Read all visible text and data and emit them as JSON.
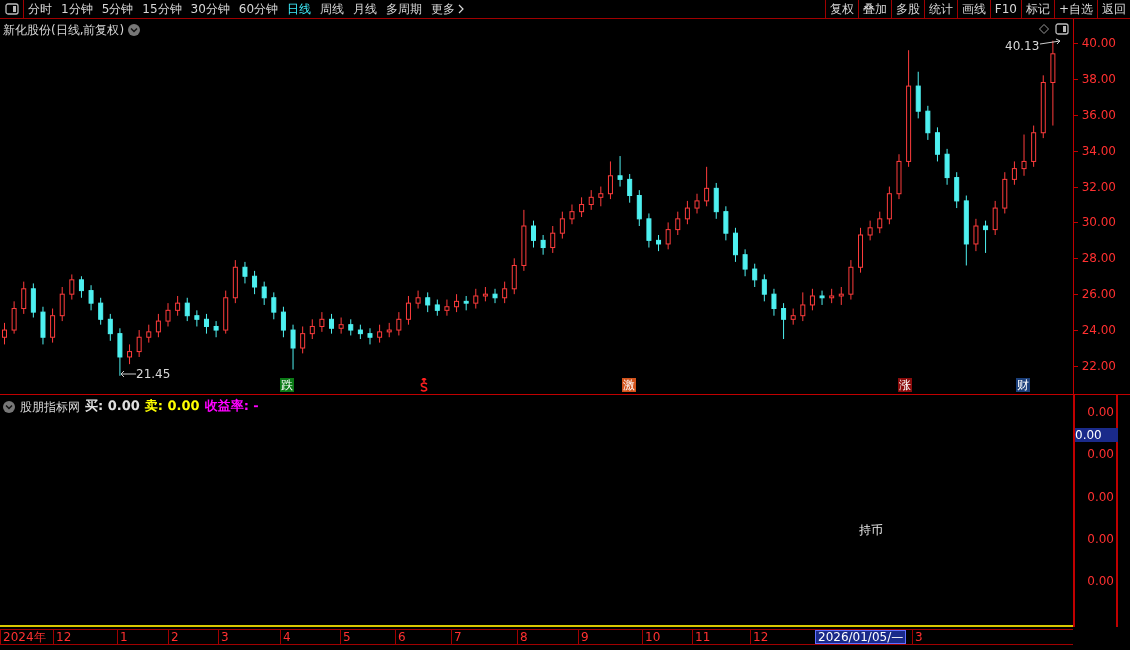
{
  "toolbar": {
    "periods": [
      {
        "label": "分时",
        "selected": false
      },
      {
        "label": "1分钟",
        "selected": false
      },
      {
        "label": "5分钟",
        "selected": false
      },
      {
        "label": "15分钟",
        "selected": false
      },
      {
        "label": "30分钟",
        "selected": false
      },
      {
        "label": "60分钟",
        "selected": false
      },
      {
        "label": "日线",
        "selected": true
      },
      {
        "label": "周线",
        "selected": false
      },
      {
        "label": "月线",
        "selected": false
      },
      {
        "label": "多周期",
        "selected": false
      }
    ],
    "more": "更多",
    "actions": [
      "复权",
      "叠加",
      "多股",
      "统计",
      "画线",
      "F10",
      "标记",
      "+自选",
      "返回"
    ]
  },
  "chart": {
    "title": "新化股份(日线,前复权)",
    "high_label": "40.13",
    "low_label": "21.45",
    "markers": [
      {
        "kind": "text",
        "text": "跌",
        "color": "#0b7a16"
      },
      {
        "kind": "dollar",
        "color": "#ff2020"
      },
      {
        "kind": "text",
        "text": "激",
        "color": "#d2531c"
      },
      {
        "kind": "text",
        "text": "涨",
        "color": "#8b0c0c"
      },
      {
        "kind": "text",
        "text": "财",
        "color": "#1b3f7a"
      }
    ],
    "chart_data": {
      "type": "candlestick",
      "ylim": [
        20.38,
        41.34
      ],
      "yticks": [
        {
          "value": 40,
          "label": "40.00"
        },
        {
          "value": 38,
          "label": "38.00"
        },
        {
          "value": 36,
          "label": "36.00"
        },
        {
          "value": 34,
          "label": "34.00"
        },
        {
          "value": 32,
          "label": "32.00"
        },
        {
          "value": 30,
          "label": "30.00"
        },
        {
          "value": 28,
          "label": "28.00"
        },
        {
          "value": 26,
          "label": "26.00"
        },
        {
          "value": 24,
          "label": "24.00"
        },
        {
          "value": 22,
          "label": "22.00"
        }
      ],
      "ohlc": [
        [
          23.6,
          24.4,
          23.2,
          24.0
        ],
        [
          24.0,
          25.6,
          23.8,
          25.2
        ],
        [
          25.2,
          26.7,
          24.9,
          26.3
        ],
        [
          26.3,
          26.6,
          24.7,
          25.0
        ],
        [
          25.0,
          25.3,
          23.2,
          23.6
        ],
        [
          23.6,
          25.2,
          23.3,
          24.8
        ],
        [
          24.8,
          26.4,
          24.5,
          26.0
        ],
        [
          26.0,
          27.1,
          25.7,
          26.8
        ],
        [
          26.8,
          27.0,
          25.8,
          26.2
        ],
        [
          26.2,
          26.5,
          25.1,
          25.5
        ],
        [
          25.5,
          25.8,
          24.3,
          24.6
        ],
        [
          24.6,
          24.9,
          23.4,
          23.8
        ],
        [
          23.8,
          24.1,
          21.45,
          22.5
        ],
        [
          22.5,
          23.2,
          22.1,
          22.8
        ],
        [
          22.8,
          24.0,
          22.5,
          23.6
        ],
        [
          23.6,
          24.3,
          23.3,
          23.9
        ],
        [
          23.9,
          24.9,
          23.6,
          24.5
        ],
        [
          24.5,
          25.5,
          24.2,
          25.1
        ],
        [
          25.1,
          25.9,
          24.8,
          25.5
        ],
        [
          25.5,
          25.8,
          24.5,
          24.8
        ],
        [
          24.8,
          25.1,
          24.2,
          24.6
        ],
        [
          24.6,
          24.9,
          23.8,
          24.2
        ],
        [
          24.2,
          24.5,
          23.6,
          24.0
        ],
        [
          24.0,
          26.2,
          23.8,
          25.8
        ],
        [
          25.8,
          27.9,
          25.5,
          27.5
        ],
        [
          27.5,
          27.8,
          26.6,
          27.0
        ],
        [
          27.0,
          27.3,
          26.0,
          26.4
        ],
        [
          26.4,
          26.7,
          25.4,
          25.8
        ],
        [
          25.8,
          26.1,
          24.6,
          25.0
        ],
        [
          25.0,
          25.3,
          23.6,
          24.0
        ],
        [
          24.0,
          24.3,
          21.8,
          23.0
        ],
        [
          23.0,
          24.2,
          22.7,
          23.8
        ],
        [
          23.8,
          24.6,
          23.5,
          24.2
        ],
        [
          24.2,
          25.0,
          23.9,
          24.6
        ],
        [
          24.6,
          24.9,
          23.8,
          24.1
        ],
        [
          24.1,
          24.7,
          23.8,
          24.3
        ],
        [
          24.3,
          24.6,
          23.7,
          24.0
        ],
        [
          24.0,
          24.3,
          23.5,
          23.8
        ],
        [
          23.8,
          24.1,
          23.2,
          23.6
        ],
        [
          23.6,
          24.3,
          23.3,
          23.9
        ],
        [
          23.9,
          24.4,
          23.6,
          24.0
        ],
        [
          24.0,
          25.0,
          23.7,
          24.6
        ],
        [
          24.6,
          25.9,
          24.3,
          25.5
        ],
        [
          25.5,
          26.2,
          25.2,
          25.8
        ],
        [
          25.8,
          26.1,
          25.0,
          25.4
        ],
        [
          25.4,
          25.7,
          24.8,
          25.1
        ],
        [
          25.1,
          25.7,
          24.8,
          25.3
        ],
        [
          25.3,
          26.0,
          25.0,
          25.6
        ],
        [
          25.6,
          25.9,
          25.1,
          25.5
        ],
        [
          25.5,
          26.3,
          25.2,
          25.9
        ],
        [
          25.9,
          26.4,
          25.6,
          26.0
        ],
        [
          26.0,
          26.3,
          25.5,
          25.8
        ],
        [
          25.8,
          26.7,
          25.5,
          26.3
        ],
        [
          26.3,
          28.0,
          26.0,
          27.6
        ],
        [
          27.6,
          30.7,
          27.3,
          29.8
        ],
        [
          29.8,
          30.1,
          28.6,
          29.0
        ],
        [
          29.0,
          29.3,
          28.2,
          28.6
        ],
        [
          28.6,
          29.8,
          28.3,
          29.4
        ],
        [
          29.4,
          30.6,
          29.1,
          30.2
        ],
        [
          30.2,
          31.0,
          29.9,
          30.6
        ],
        [
          30.6,
          31.4,
          30.3,
          31.0
        ],
        [
          31.0,
          31.8,
          30.7,
          31.4
        ],
        [
          31.4,
          32.0,
          30.9,
          31.6
        ],
        [
          31.6,
          33.4,
          31.3,
          32.6
        ],
        [
          32.6,
          33.7,
          32.0,
          32.4
        ],
        [
          32.4,
          32.7,
          31.1,
          31.5
        ],
        [
          31.5,
          31.8,
          29.8,
          30.2
        ],
        [
          30.2,
          30.5,
          28.6,
          29.0
        ],
        [
          29.0,
          29.3,
          28.4,
          28.8
        ],
        [
          28.8,
          30.0,
          28.5,
          29.6
        ],
        [
          29.6,
          30.6,
          29.3,
          30.2
        ],
        [
          30.2,
          31.2,
          29.9,
          30.8
        ],
        [
          30.8,
          31.6,
          30.5,
          31.2
        ],
        [
          31.2,
          33.1,
          30.9,
          31.9
        ],
        [
          31.9,
          32.2,
          30.2,
          30.6
        ],
        [
          30.6,
          30.9,
          29.0,
          29.4
        ],
        [
          29.4,
          29.7,
          27.8,
          28.2
        ],
        [
          28.2,
          28.5,
          27.0,
          27.4
        ],
        [
          27.4,
          27.7,
          26.4,
          26.8
        ],
        [
          26.8,
          27.1,
          25.6,
          26.0
        ],
        [
          26.0,
          26.3,
          24.8,
          25.2
        ],
        [
          25.2,
          25.5,
          23.5,
          24.6
        ],
        [
          24.6,
          25.2,
          24.3,
          24.8
        ],
        [
          24.8,
          26.1,
          24.5,
          25.4
        ],
        [
          25.4,
          26.3,
          25.1,
          25.9
        ],
        [
          25.9,
          26.2,
          25.4,
          25.8
        ],
        [
          25.8,
          26.3,
          25.5,
          25.9
        ],
        [
          25.9,
          26.4,
          25.4,
          26.0
        ],
        [
          26.0,
          27.9,
          25.7,
          27.5
        ],
        [
          27.5,
          29.7,
          27.2,
          29.3
        ],
        [
          29.3,
          30.1,
          29.0,
          29.7
        ],
        [
          29.7,
          30.6,
          29.4,
          30.2
        ],
        [
          30.2,
          32.0,
          29.9,
          31.6
        ],
        [
          31.6,
          33.8,
          31.3,
          33.4
        ],
        [
          33.4,
          39.6,
          33.1,
          37.6
        ],
        [
          37.6,
          38.4,
          35.8,
          36.2
        ],
        [
          36.2,
          36.5,
          34.6,
          35.0
        ],
        [
          35.0,
          35.3,
          33.4,
          33.8
        ],
        [
          33.8,
          34.1,
          32.1,
          32.5
        ],
        [
          32.5,
          32.8,
          30.8,
          31.2
        ],
        [
          31.2,
          31.5,
          27.6,
          28.8
        ],
        [
          28.8,
          30.2,
          28.4,
          29.8
        ],
        [
          29.8,
          30.1,
          28.3,
          29.6
        ],
        [
          29.6,
          31.2,
          29.3,
          30.8
        ],
        [
          30.8,
          32.8,
          30.5,
          32.4
        ],
        [
          32.4,
          33.4,
          32.1,
          33.0
        ],
        [
          33.0,
          34.9,
          32.6,
          33.4
        ],
        [
          33.4,
          35.4,
          33.1,
          35.0
        ],
        [
          35.0,
          38.2,
          34.7,
          37.8
        ],
        [
          37.8,
          40.13,
          35.4,
          39.4
        ]
      ]
    }
  },
  "indicator": {
    "name": "股朋指标网",
    "legend": [
      {
        "text": "买: 0.00",
        "color": "#e0e0e0"
      },
      {
        "text": "卖: 0.00",
        "color": "#ffff00"
      },
      {
        "text": "收益率: -",
        "color": "#ff00ff"
      }
    ],
    "axis": [
      "0.00",
      "0.00",
      "0.00",
      "0.00",
      "0.00"
    ],
    "cursor_value": "0.00",
    "note": "持币"
  },
  "timeline": [
    {
      "label": "2024年",
      "highlighted": false
    },
    {
      "label": "12",
      "highlighted": false
    },
    {
      "label": "1",
      "highlighted": false
    },
    {
      "label": "2",
      "highlighted": false
    },
    {
      "label": "3",
      "highlighted": false
    },
    {
      "label": "4",
      "highlighted": false
    },
    {
      "label": "5",
      "highlighted": false
    },
    {
      "label": "6",
      "highlighted": false
    },
    {
      "label": "7",
      "highlighted": false
    },
    {
      "label": "8",
      "highlighted": false
    },
    {
      "label": "9",
      "highlighted": false
    },
    {
      "label": "10",
      "highlighted": false
    },
    {
      "label": "11",
      "highlighted": false
    },
    {
      "label": "12",
      "highlighted": false
    },
    {
      "label": "2026/01/05/—",
      "highlighted": true
    },
    {
      "label": "3",
      "highlighted": false
    }
  ]
}
